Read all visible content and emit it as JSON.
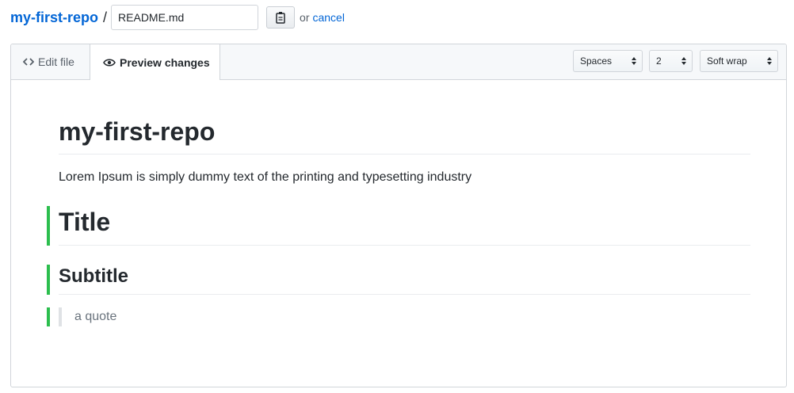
{
  "header": {
    "repo_name": "my-first-repo",
    "separator": "/",
    "filename_value": "README.md",
    "clipboard_icon": "clipboard-icon",
    "or_text": "or",
    "cancel_label": "cancel"
  },
  "editor": {
    "tabs": [
      {
        "label": "Edit file",
        "icon": "code-icon"
      },
      {
        "label": "Preview changes",
        "icon": "eye-icon"
      }
    ],
    "indent_mode": "Spaces",
    "indent_size": "2",
    "wrap_mode": "Soft wrap"
  },
  "preview": {
    "heading": "my-first-repo",
    "paragraph": "Lorem Ipsum is simply dummy text of the printing and typesetting industry",
    "title": "Title",
    "subtitle": "Subtitle",
    "quote": "a quote"
  },
  "colors": {
    "link": "#0366d6",
    "added_marker": "#2cbe4e"
  }
}
